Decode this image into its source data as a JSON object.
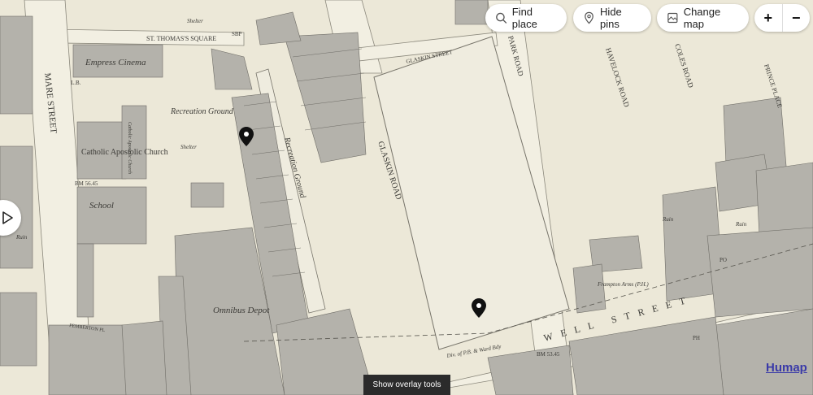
{
  "toolbar": {
    "find_place": "Find place",
    "hide_pins": "Hide pins",
    "change_map": "Change map",
    "zoom_in": "+",
    "zoom_out": "−"
  },
  "overlay": {
    "show_tools": "Show overlay tools"
  },
  "brand": {
    "name": "Humap"
  },
  "map_labels": {
    "st_thomas_square": "ST. THOMAS'S SQUARE",
    "glaskin_street": "GLASKIN STREET",
    "park_road": "PARK ROAD",
    "havelock_road": "HAVELOCK ROAD",
    "coles_road": "COLES ROAD",
    "prince_place": "PRINCE PLACE",
    "empress_cinema": "Empress Cinema",
    "recreation_ground_1": "Recreation Ground",
    "recreation_ground_2": "Recreation Ground",
    "catholic_apostolic_church": "Catholic Apostolic Church",
    "catholic_church_small": "Catholic Apostolic Church",
    "shelter_1": "Shelter",
    "shelter_2": "Shelter",
    "school": "School",
    "bm_1": "BM 56.45",
    "bm_2": "BM 53.45",
    "ruin_1": "Ruin",
    "ruin_2": "Ruin",
    "ruin_3": "Ruin",
    "glaskin_road": "GLASKIN ROAD",
    "mare_street": "MARE STREET",
    "pemberton_pl": "PEMBERTON PL",
    "omnibus_depot": "Omnibus Depot",
    "frampton_arms": "Frampton Arms (P.H.)",
    "well_street": "WELL STREET",
    "ward_bdy": "Div. of P.B. & Ward Bdy",
    "lb": "L.B.",
    "sbp": "SBP",
    "ph": "PH",
    "po": "PO"
  },
  "pins": [
    {
      "name": "map-pin-1"
    },
    {
      "name": "map-pin-2"
    }
  ],
  "colors": {
    "paper": "#ece8d8",
    "building": "#b4b2ab",
    "ink": "#3b3a36",
    "brand": "#3a3aa8"
  }
}
